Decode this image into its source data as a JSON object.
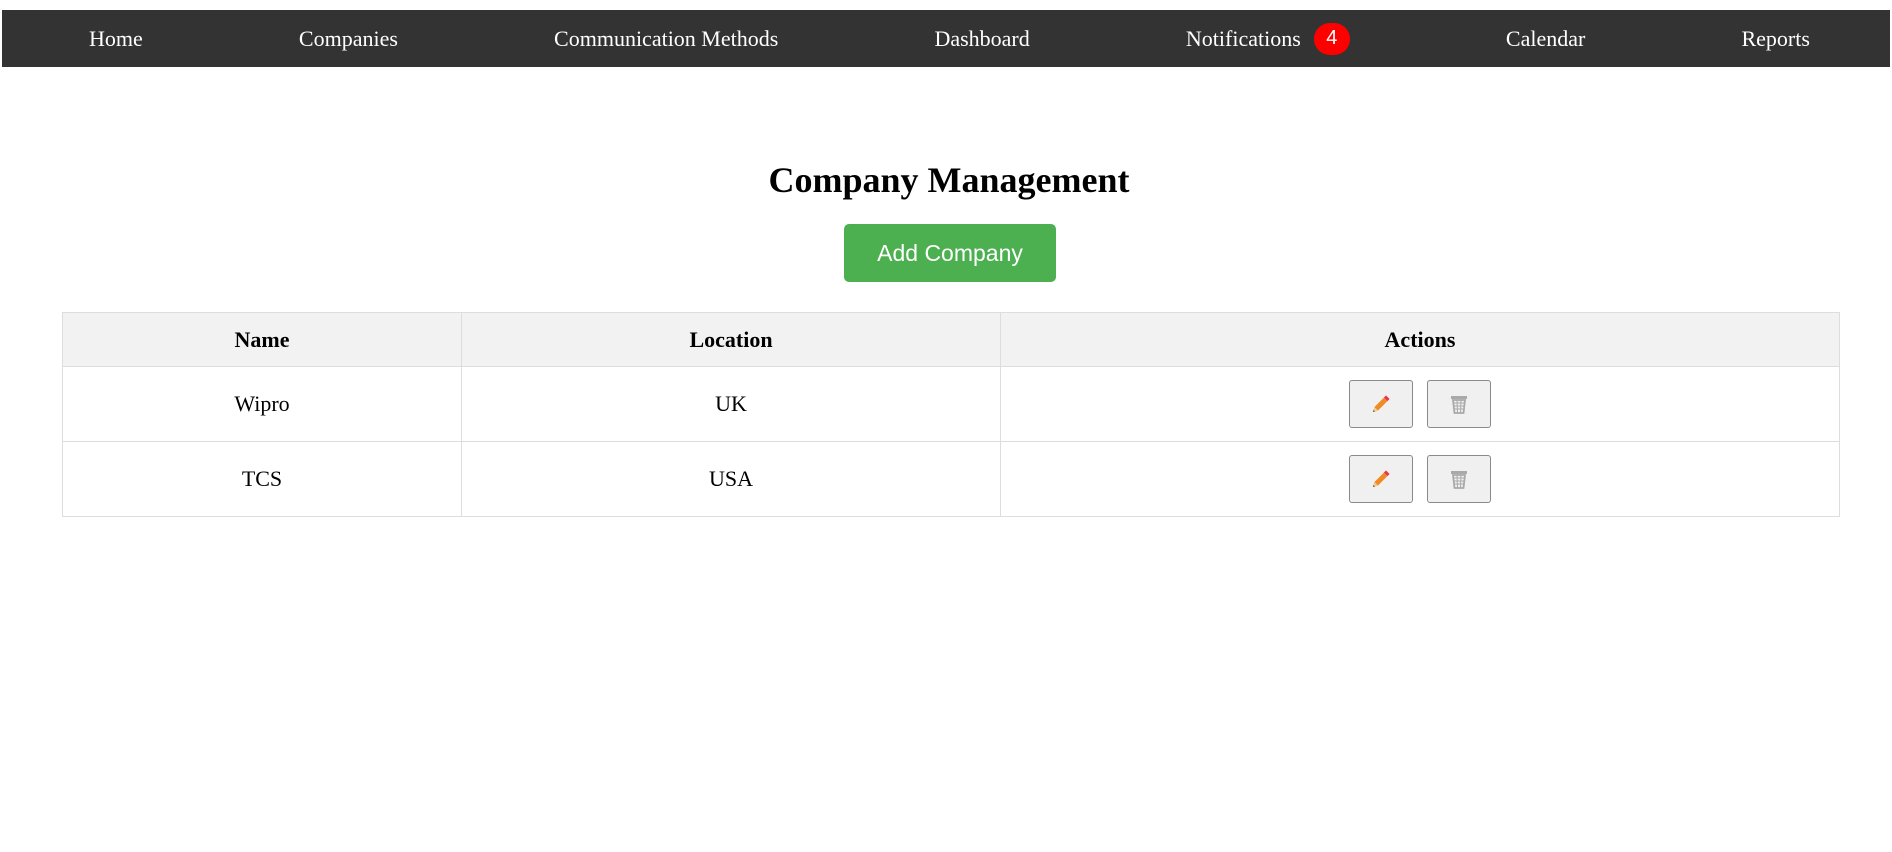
{
  "nav": {
    "items": [
      {
        "label": "Home"
      },
      {
        "label": "Companies"
      },
      {
        "label": "Communication Methods"
      },
      {
        "label": "Dashboard"
      },
      {
        "label": "Notifications",
        "badge": "4"
      },
      {
        "label": "Calendar"
      },
      {
        "label": "Reports"
      }
    ]
  },
  "main": {
    "title": "Company Management",
    "add_button_label": "Add Company"
  },
  "table": {
    "headers": [
      "Name",
      "Location",
      "Actions"
    ],
    "rows": [
      {
        "name": "Wipro",
        "location": "UK",
        "actions": [
          "pencil-icon",
          "trash-icon"
        ]
      },
      {
        "name": "TCS",
        "location": "USA",
        "actions": [
          "pencil-icon",
          "trash-icon"
        ]
      }
    ]
  },
  "colors": {
    "navbar": "#333333",
    "badge": "#ff0000",
    "add_button": "#4caf50",
    "header_bg": "#f2f2f2"
  }
}
